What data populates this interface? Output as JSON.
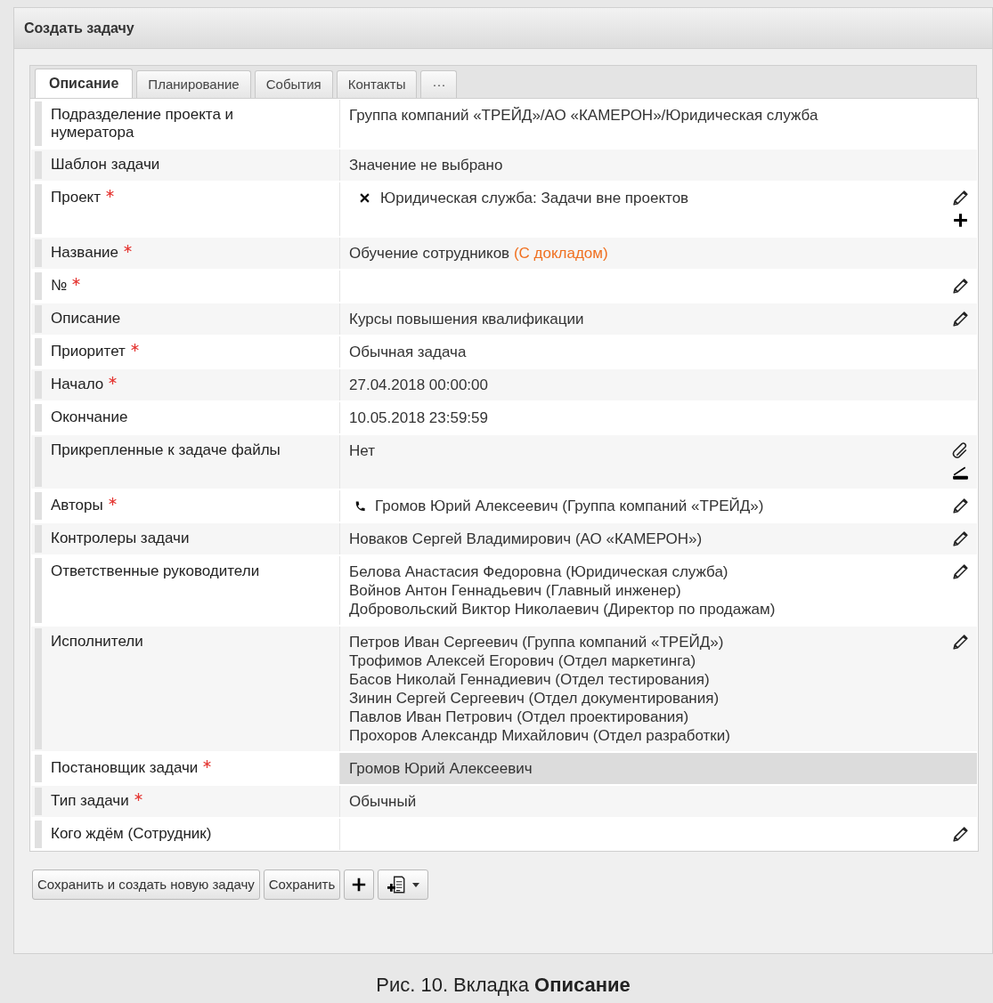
{
  "window": {
    "title": "Создать задачу"
  },
  "tabs": [
    {
      "label": "Описание",
      "selected": true
    },
    {
      "label": "Планирование",
      "selected": false
    },
    {
      "label": "События",
      "selected": false
    },
    {
      "label": "Контакты",
      "selected": false
    },
    {
      "label": "···",
      "selected": false
    }
  ],
  "fields": [
    {
      "label": "Подразделение проекта и нумератора",
      "required": false,
      "lines": [
        "Группа компаний «ТРЕЙД»/АО «КАМЕРОН»/Юридическая служба"
      ]
    },
    {
      "label": "Шаблон задачи",
      "required": false,
      "lines": [
        "Значение не выбрано"
      ]
    },
    {
      "label": "Проект",
      "required": true,
      "prefix": {
        "kind": "remove"
      },
      "lines": [
        "Юридическая служба: Задачи вне проектов"
      ],
      "actions": [
        {
          "kind": "edit"
        },
        {
          "kind": "add"
        }
      ]
    },
    {
      "label": "Название",
      "required": true,
      "lines": [
        "Обучение сотрудников"
      ],
      "note": "(С докладом)"
    },
    {
      "label": "№",
      "required": true,
      "actions": [
        {
          "kind": "edit"
        }
      ]
    },
    {
      "label": "Описание",
      "required": false,
      "lines": [
        "Курсы повышения квалификации"
      ],
      "actions": [
        {
          "kind": "edit"
        }
      ]
    },
    {
      "label": "Приоритет",
      "required": true,
      "lines": [
        "Обычная задача"
      ]
    },
    {
      "label": "Начало",
      "required": true,
      "lines": [
        "27.04.2018 00:00:00"
      ]
    },
    {
      "label": "Окончание",
      "required": false,
      "lines": [
        "10.05.2018 23:59:59"
      ]
    },
    {
      "label": "Прикрепленные к задаче файлы",
      "required": false,
      "lines": [
        "Нет"
      ],
      "actions": [
        {
          "kind": "attach"
        },
        {
          "kind": "scan"
        }
      ]
    },
    {
      "label": "Авторы",
      "required": true,
      "prefix": {
        "kind": "phone"
      },
      "lines": [
        "Громов Юрий Алексеевич (Группа компаний «ТРЕЙД»)"
      ],
      "actions": [
        {
          "kind": "edit"
        }
      ]
    },
    {
      "label": "Контролеры задачи",
      "required": false,
      "lines": [
        "Новаков Сергей Владимирович (АО «КАМЕРОН»)"
      ],
      "actions": [
        {
          "kind": "edit"
        }
      ]
    },
    {
      "label": "Ответственные руководители",
      "required": false,
      "lines": [
        "Белова Анастасия Федоровна (Юридическая служба)",
        "Войнов Антон Геннадьевич (Главный инженер)",
        "Добровольский Виктор Николаевич (Директор по продажам)"
      ],
      "actions": [
        {
          "kind": "edit"
        }
      ]
    },
    {
      "label": "Исполнители",
      "required": false,
      "lines": [
        "Петров Иван Сергеевич (Группа компаний «ТРЕЙД»)",
        "Трофимов Алексей Егорович (Отдел маркетинга)",
        "Басов Николай Геннадиевич (Отдел тестирования)",
        "Зинин Сергей Сергеевич (Отдел документирования)",
        "Павлов Иван Петрович (Отдел проектирования)",
        "Прохоров Александр Михайлович (Отдел разработки)"
      ],
      "actions": [
        {
          "kind": "edit"
        }
      ]
    },
    {
      "label": "Постановщик задачи",
      "required": true,
      "readonly": true,
      "lines": [
        "Громов Юрий Алексеевич"
      ]
    },
    {
      "label": "Тип задачи",
      "required": true,
      "lines": [
        "Обычный"
      ]
    },
    {
      "label": "Кого ждём (Сотрудник)",
      "required": false,
      "actions": [
        {
          "kind": "edit"
        }
      ]
    }
  ],
  "buttons": [
    {
      "kind": "text",
      "label": "Сохранить и создать новую задачу"
    },
    {
      "kind": "text",
      "label": "Сохранить"
    },
    {
      "kind": "add"
    },
    {
      "kind": "document-menu"
    }
  ],
  "caption": "Рис. 10. Вкладка **Описание**"
}
